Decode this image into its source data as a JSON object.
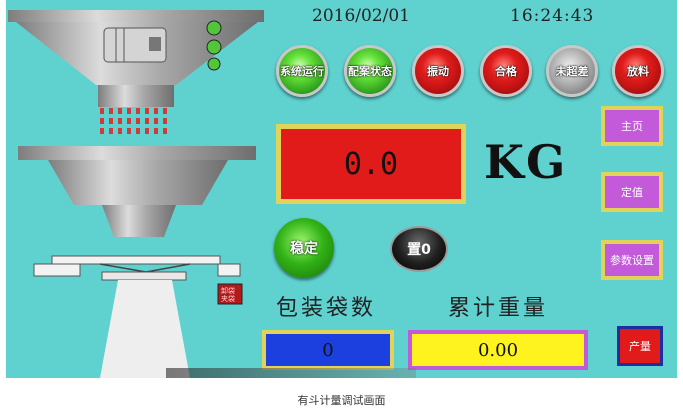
{
  "header": {
    "date": "2016/02/01",
    "time": "16:24:43"
  },
  "indicators": {
    "system_running": "系统运行",
    "formula_status": "配案状态",
    "vibrate": "振动",
    "pass": "合格",
    "not_over": "未超差",
    "discharge": "放料"
  },
  "weight": {
    "value": "0.0",
    "unit": "KG"
  },
  "controls": {
    "stable": "稳定",
    "zero": "置0"
  },
  "sidebar": {
    "home": "主页",
    "setpoint": "定值",
    "params": "参数设置",
    "output": "产量"
  },
  "counters": {
    "bag_count_label": "包装袋数",
    "bag_count_value": "0",
    "total_weight_label": "累计重量",
    "total_weight_value": "0.00"
  },
  "machine": {
    "plate": "卸袋\n夹袋"
  },
  "colors": {
    "panel_bg": "#5fd2d0",
    "display_red": "#e11a1a",
    "button_purple": "#c25ad9",
    "frame_yellow": "#e1d35a",
    "counter_blue": "#1c3fe0",
    "counter_yellow": "#fff31f"
  },
  "caption": "有斗计量调试画面"
}
